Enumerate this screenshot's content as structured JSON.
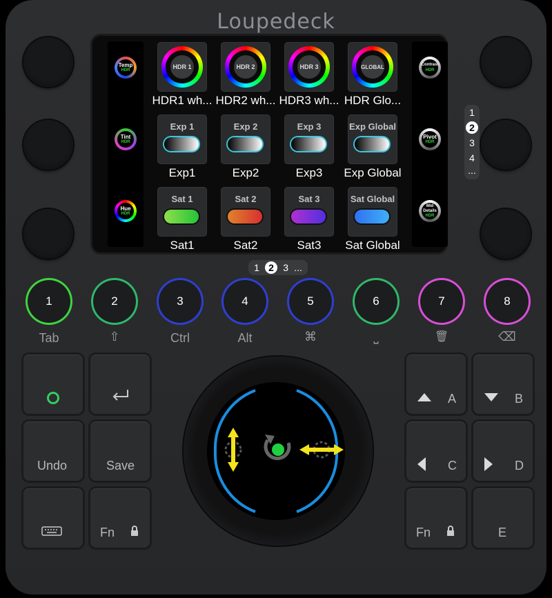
{
  "brand": "Loupedeck",
  "left_dials": [
    {
      "label": "Temp",
      "badge": "HDR"
    },
    {
      "label": "Tint",
      "badge": "HDR"
    },
    {
      "label": "Hue",
      "badge": "HDR"
    }
  ],
  "right_dials": [
    {
      "label": "Contrast",
      "badge": "HDR"
    },
    {
      "label": "Pivot",
      "badge": "HDR"
    },
    {
      "label": "Mid Details",
      "badge": "HDR"
    }
  ],
  "tiles_row1": [
    {
      "inner": "HDR 1",
      "caption": "HDR1 wh..."
    },
    {
      "inner": "HDR 2",
      "caption": "HDR2 wh..."
    },
    {
      "inner": "HDR 3",
      "caption": "HDR3 wh..."
    },
    {
      "inner": "GLOBAL",
      "caption": "HDR Glo..."
    }
  ],
  "tiles_row2": [
    {
      "title": "Exp 1",
      "caption": "Exp1"
    },
    {
      "title": "Exp 2",
      "caption": "Exp2"
    },
    {
      "title": "Exp 3",
      "caption": "Exp3"
    },
    {
      "title": "Exp Global",
      "caption": "Exp Global"
    }
  ],
  "tiles_row3": [
    {
      "title": "Sat 1",
      "caption": "Sat1",
      "color": "#3fd43f"
    },
    {
      "title": "Sat 2",
      "caption": "Sat2",
      "color": "#e0472c"
    },
    {
      "title": "Sat 3",
      "caption": "Sat3",
      "color": "#a03ce0"
    },
    {
      "title": "Sat Global",
      "caption": "Sat Global",
      "color": "#3d8ef0"
    }
  ],
  "side_pager": {
    "p1": "1",
    "current": "2",
    "p3": "3",
    "p4": "4",
    "more": "..."
  },
  "bottom_pager": {
    "p1": "1",
    "current": "2",
    "p3": "3",
    "more": "..."
  },
  "round_buttons": [
    {
      "num": "1",
      "label": "Tab",
      "color": "#3fd43f"
    },
    {
      "num": "2",
      "label": "⇧",
      "color": "#2fb86a"
    },
    {
      "num": "3",
      "label": "Ctrl",
      "color": "#2f3fd0"
    },
    {
      "num": "4",
      "label": "Alt",
      "color": "#2f3fd0"
    },
    {
      "num": "5",
      "label": "⌘",
      "color": "#2f3fd0"
    },
    {
      "num": "6",
      "label": "⎵",
      "color": "#2fb86a"
    },
    {
      "num": "7",
      "label": "🗑",
      "color": "#d84fd8"
    },
    {
      "num": "8",
      "label": "⌫",
      "color": "#d84fd8"
    }
  ],
  "left_keys": {
    "undo": "Undo",
    "save": "Save",
    "fn": "Fn"
  },
  "right_keys": {
    "a": "A",
    "b": "B",
    "c": "C",
    "d": "D",
    "fn": "Fn",
    "e": "E"
  }
}
